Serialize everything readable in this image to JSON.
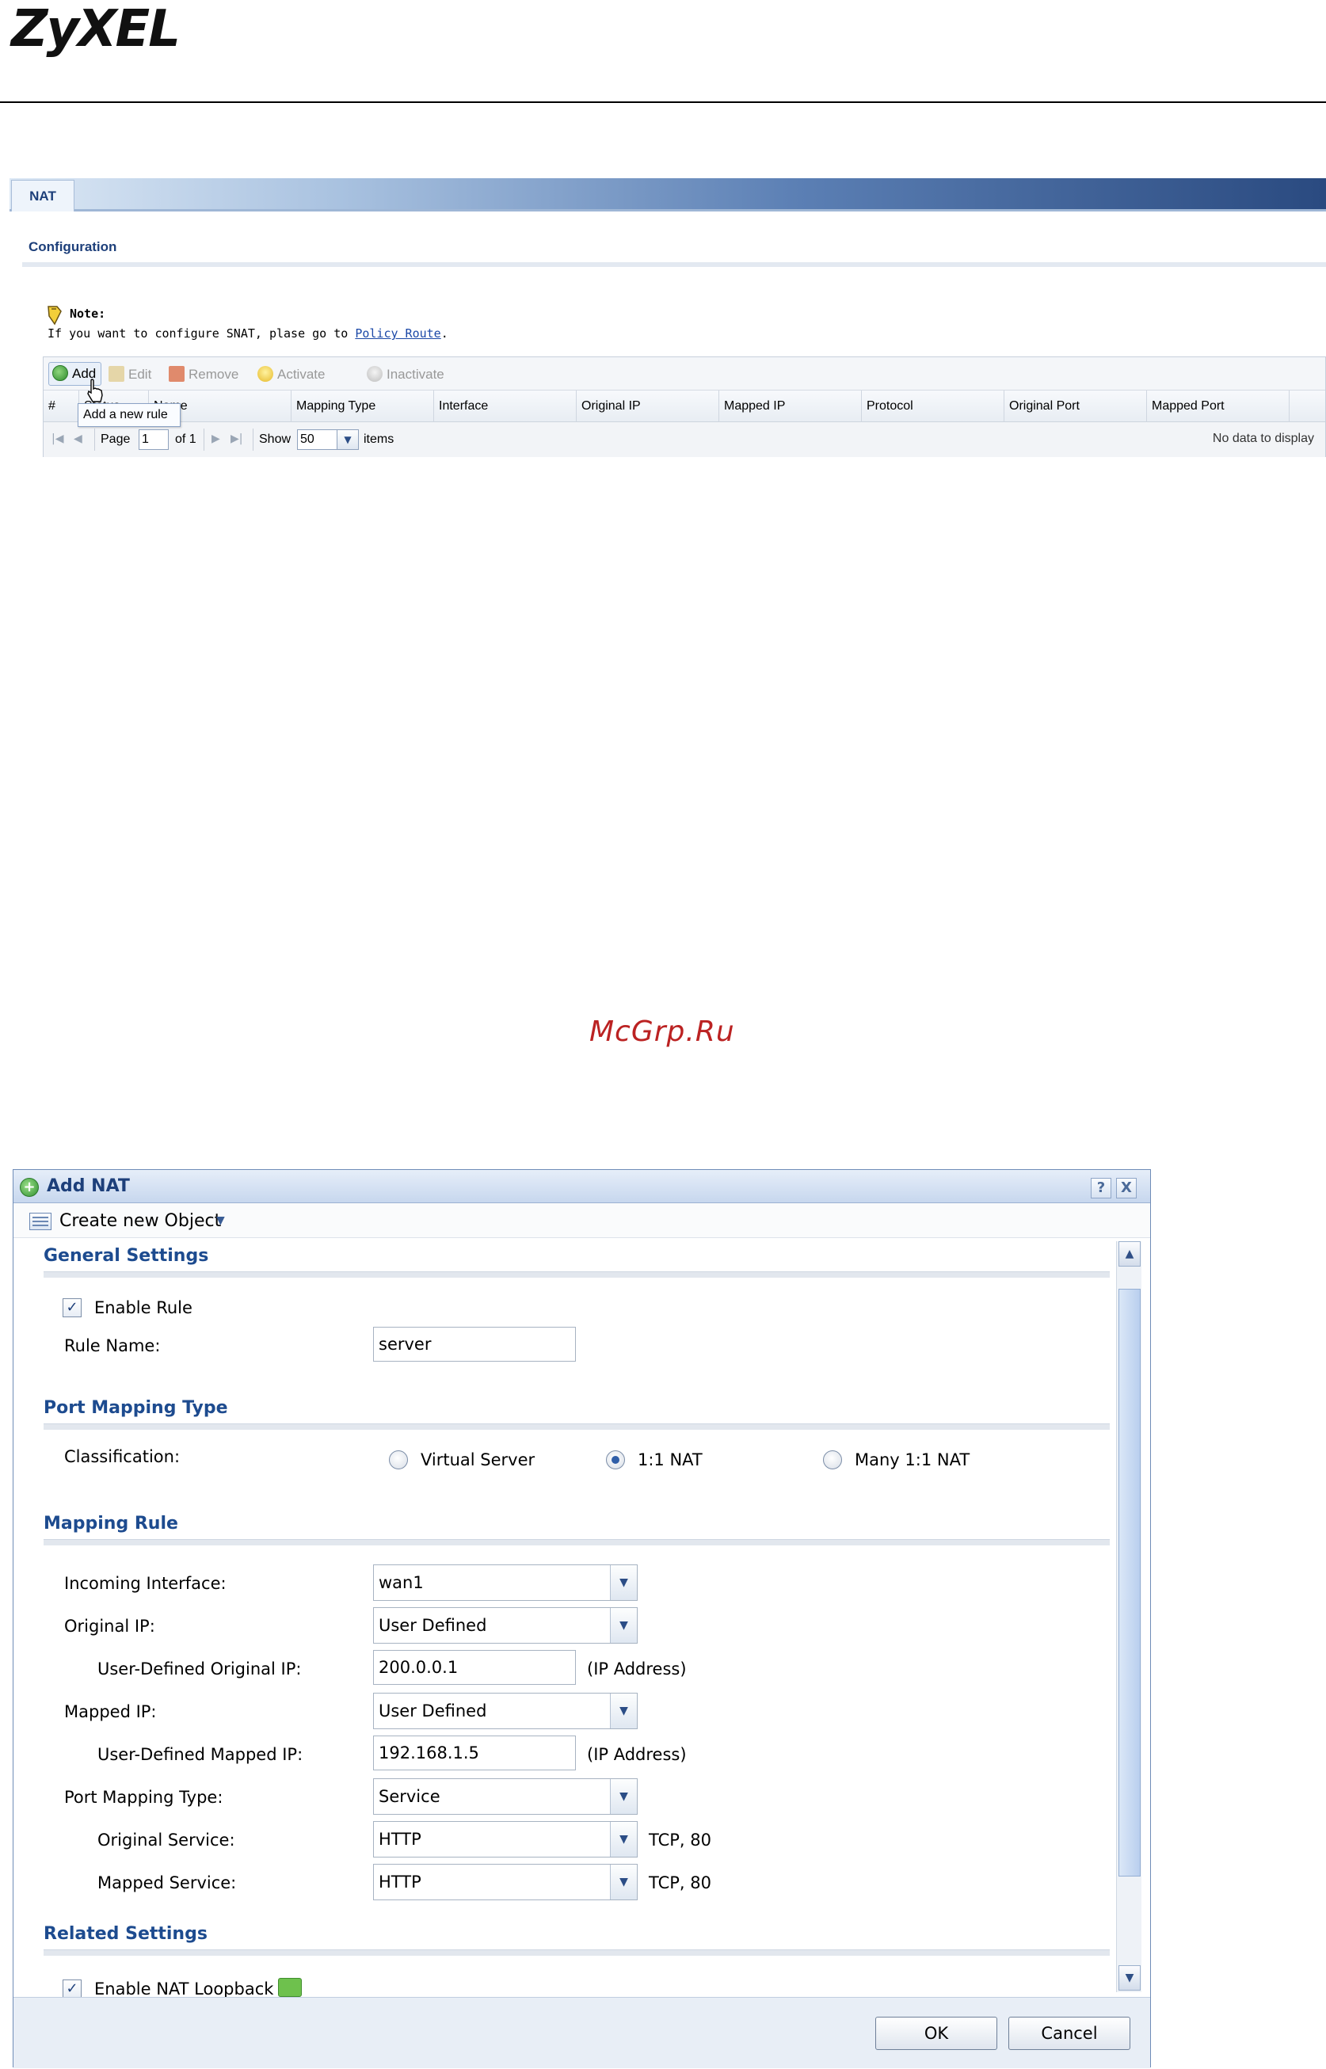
{
  "brand": {
    "logo_text": "ZyXEL"
  },
  "nat_screen": {
    "tab_label": "NAT",
    "section_title": "Configuration",
    "note": {
      "title": "Note:",
      "text_before": "If you want to configure SNAT, plase go to ",
      "link": "Policy Route",
      "text_after": "."
    },
    "toolbar": {
      "add": "Add",
      "edit": "Edit",
      "remove": "Remove",
      "activate": "Activate",
      "inactivate": "Inactivate"
    },
    "tooltip": "Add a new rule",
    "columns": [
      "#",
      "Status",
      "Name",
      "Mapping Type",
      "Interface",
      "Original IP",
      "Mapped IP",
      "Protocol",
      "Original Port",
      "Mapped Port"
    ],
    "pager": {
      "page_label": "Page",
      "page_value": "1",
      "of_label": "of 1",
      "show_label": "Show",
      "show_value": "50",
      "items_label": "items",
      "status": "No data to display"
    }
  },
  "watermark": "McGrp.Ru",
  "dialog": {
    "title": "Add NAT",
    "help_label": "?",
    "close_label": "X",
    "create_object": "Create new Object",
    "general": {
      "title": "General Settings",
      "enable_rule_label": "Enable Rule",
      "enable_rule_checked": true,
      "rule_name_label": "Rule Name:",
      "rule_name_value": "server"
    },
    "port_mapping": {
      "title": "Port Mapping Type",
      "classification_label": "Classification:",
      "options": [
        "Virtual Server",
        "1:1 NAT",
        "Many 1:1 NAT"
      ],
      "selected": "1:1 NAT"
    },
    "mapping_rule": {
      "title": "Mapping Rule",
      "incoming_interface_label": "Incoming Interface:",
      "incoming_interface_value": "wan1",
      "original_ip_label": "Original IP:",
      "original_ip_value": "User Defined",
      "ud_original_ip_label": "User-Defined Original IP:",
      "ud_original_ip_value": "200.0.0.1",
      "ip_address_hint": "(IP Address)",
      "mapped_ip_label": "Mapped IP:",
      "mapped_ip_value": "User Defined",
      "ud_mapped_ip_label": "User-Defined Mapped IP:",
      "ud_mapped_ip_value": "192.168.1.5",
      "port_mapping_type_label": "Port Mapping Type:",
      "port_mapping_type_value": "Service",
      "original_service_label": "Original Service:",
      "original_service_value": "HTTP",
      "original_service_hint": "TCP, 80",
      "mapped_service_label": "Mapped Service:",
      "mapped_service_value": "HTTP",
      "mapped_service_hint": "TCP, 80"
    },
    "related": {
      "title": "Related Settings",
      "nat_loopback_label": "Enable NAT Loopback",
      "nat_loopback_checked": true
    },
    "ok_label": "OK",
    "cancel_label": "Cancel"
  }
}
